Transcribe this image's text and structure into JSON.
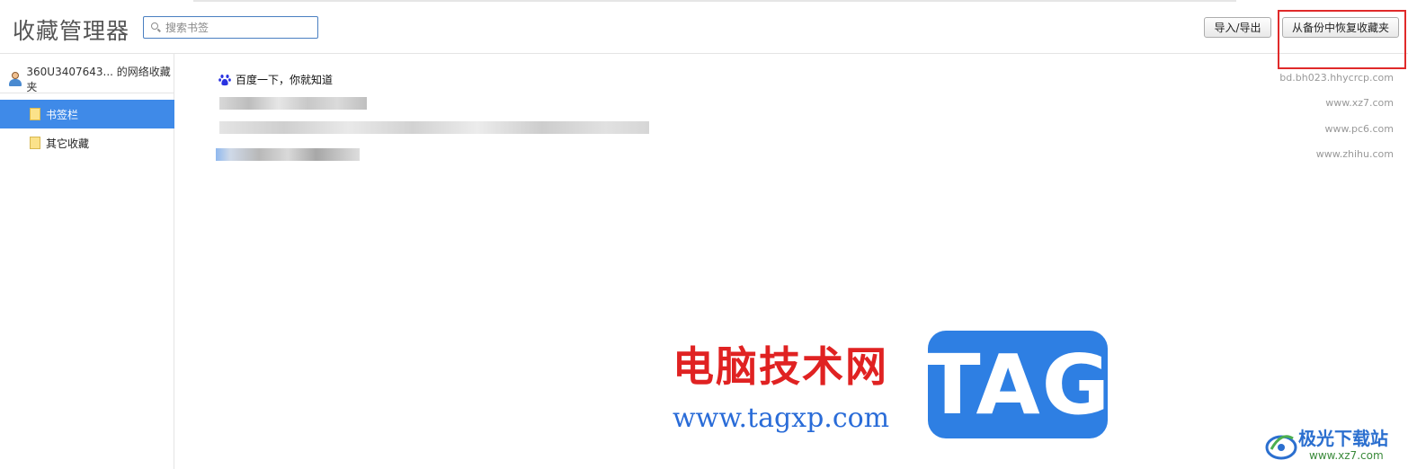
{
  "header": {
    "title": "收藏管理器",
    "search_placeholder": "搜索书签",
    "import_export_label": "导入/导出",
    "restore_label": "从备份中恢复收藏夹"
  },
  "sidebar": {
    "account_label": "360U3407643... 的网络收藏夹",
    "folders": [
      {
        "label": "书签栏",
        "selected": true
      },
      {
        "label": "其它收藏",
        "selected": false
      }
    ]
  },
  "bookmarks": [
    {
      "title": "百度一下，你就知道",
      "url": "bd.bh023.hhycrcp.com",
      "icon": "baidu-paw-icon"
    },
    {
      "title": "",
      "url": "www.xz7.com",
      "blurred": true
    },
    {
      "title": "",
      "url": "www.pc6.com",
      "blurred": true
    },
    {
      "title": "",
      "url": "www.zhihu.com",
      "blurred": true
    }
  ],
  "watermark": {
    "site_name": "电脑技术网",
    "site_url": "www.tagxp.com",
    "tag_text": "TAG",
    "logo_name": "极光下载站",
    "logo_url": "www.xz7.com"
  },
  "colors": {
    "selected_bg": "#3f8ae8",
    "highlight_border": "#e02a2a",
    "search_border": "#4a7fc1"
  }
}
